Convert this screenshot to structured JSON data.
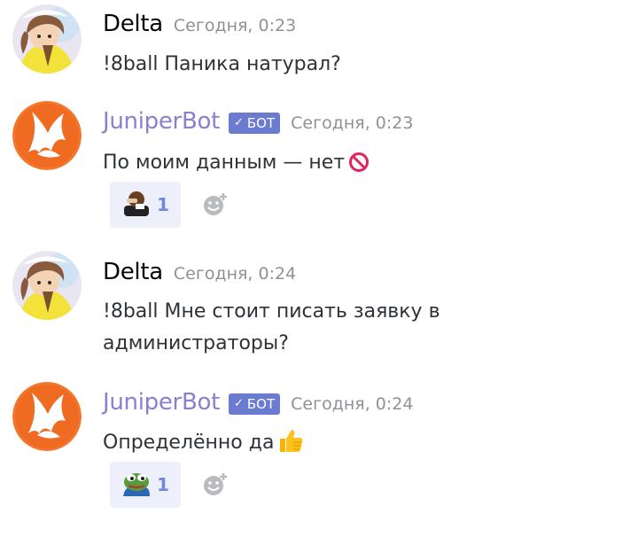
{
  "messages": [
    {
      "author": "Delta",
      "timestamp": "Сегодня, 0:23",
      "text": "!8ball Паника натурал?",
      "is_bot": false
    },
    {
      "author": "JuniperBot",
      "bot_tag": "БОТ",
      "timestamp": "Сегодня, 0:23",
      "text": "По моим данным — нет",
      "text_emoji": "no-entry-icon",
      "is_bot": true,
      "reaction": {
        "emoji": "facepalm-man-icon",
        "count": "1"
      }
    },
    {
      "author": "Delta",
      "timestamp": "Сегодня, 0:24",
      "text": "!8ball Мне стоит писать заявку в администраторы?",
      "is_bot": false
    },
    {
      "author": "JuniperBot",
      "bot_tag": "БОТ",
      "timestamp": "Сегодня, 0:24",
      "text": "Определённо да",
      "text_emoji": "thumbs-up-icon",
      "is_bot": true,
      "reaction": {
        "emoji": "pepe-frog-icon",
        "count": "1"
      }
    }
  ],
  "colors": {
    "username_user": "#060607",
    "username_bot": "#8b7fd0",
    "bot_tag_bg": "#6a7bd0",
    "timestamp": "#8e9297",
    "reaction_bg": "#edf0fb",
    "reaction_count": "#7088d8"
  }
}
